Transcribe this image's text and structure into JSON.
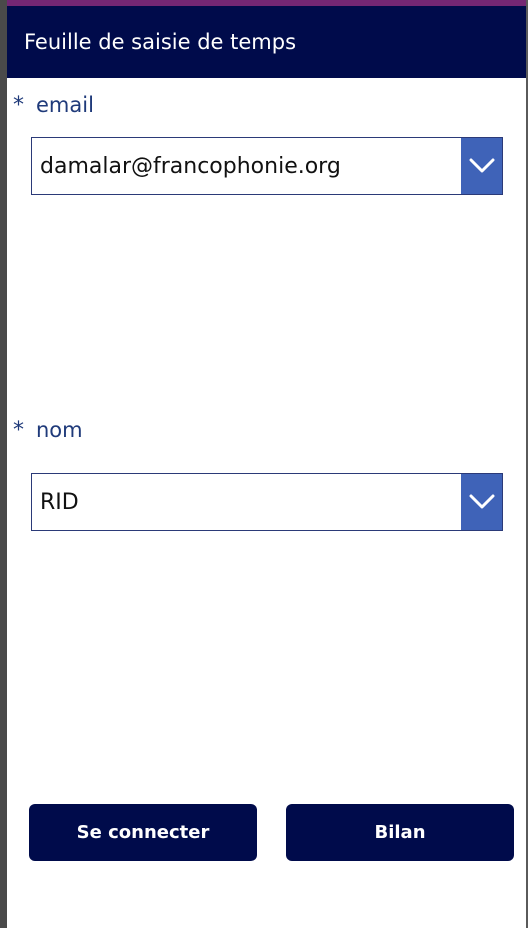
{
  "header": {
    "title": "Feuille de saisie de temps"
  },
  "fields": {
    "email": {
      "required_mark": "*",
      "label": "email",
      "value": "damalar@francophonie.org",
      "icon": "chevron-down-icon"
    },
    "nom": {
      "required_mark": "*",
      "label": "nom",
      "value": "RID",
      "icon": "chevron-down-icon"
    }
  },
  "actions": {
    "connect_label": "Se connecter",
    "summary_label": "Bilan"
  },
  "colors": {
    "header_bg": "#000b4b",
    "accent": "#3f63b8",
    "label": "#1f3a7a",
    "top_strip": "#742774"
  }
}
